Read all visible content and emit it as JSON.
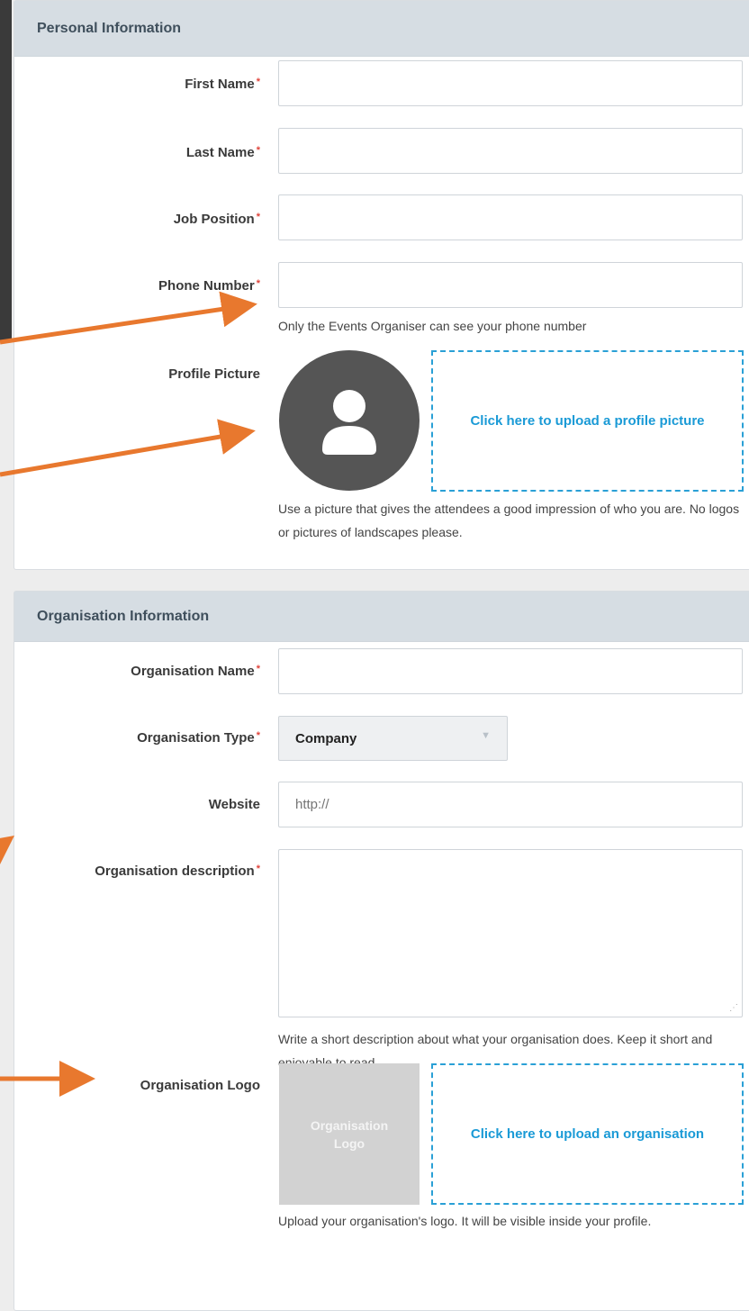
{
  "personal": {
    "header": "Personal Information",
    "fields": {
      "first_name": "First Name",
      "last_name": "Last Name",
      "job_position": "Job Position",
      "phone_number": "Phone Number",
      "profile_picture": "Profile Picture"
    },
    "required_marker": "*",
    "phone_help": "Only the Events Organiser can see your phone number",
    "upload_profile": "Click here to upload a profile picture",
    "picture_help": "Use a picture that gives the attendees a good impression of who you are. No logos or pictures of landscapes please."
  },
  "organisation": {
    "header": "Organisation Information",
    "fields": {
      "name": "Organisation Name",
      "type": "Organisation Type",
      "website": "Website",
      "description": "Organisation description",
      "logo": "Organisation Logo"
    },
    "type_value": "Company",
    "website_placeholder": "http://",
    "description_help": "Write a short description about what your organisation does. Keep it short and enjoyable to read.",
    "logo_placeholder": "Organisation Logo",
    "upload_logo": "Click here to upload an organisation",
    "logo_help": "Upload your organisation's logo. It will be visible inside your profile."
  },
  "colors": {
    "accent": "#1a9ad6",
    "arrow": "#e8782e",
    "required": "#e0453c",
    "header_bg": "#d6dde3"
  },
  "icons": {
    "avatar": "user-silhouette-icon",
    "dropdown": "caret-down-icon"
  }
}
